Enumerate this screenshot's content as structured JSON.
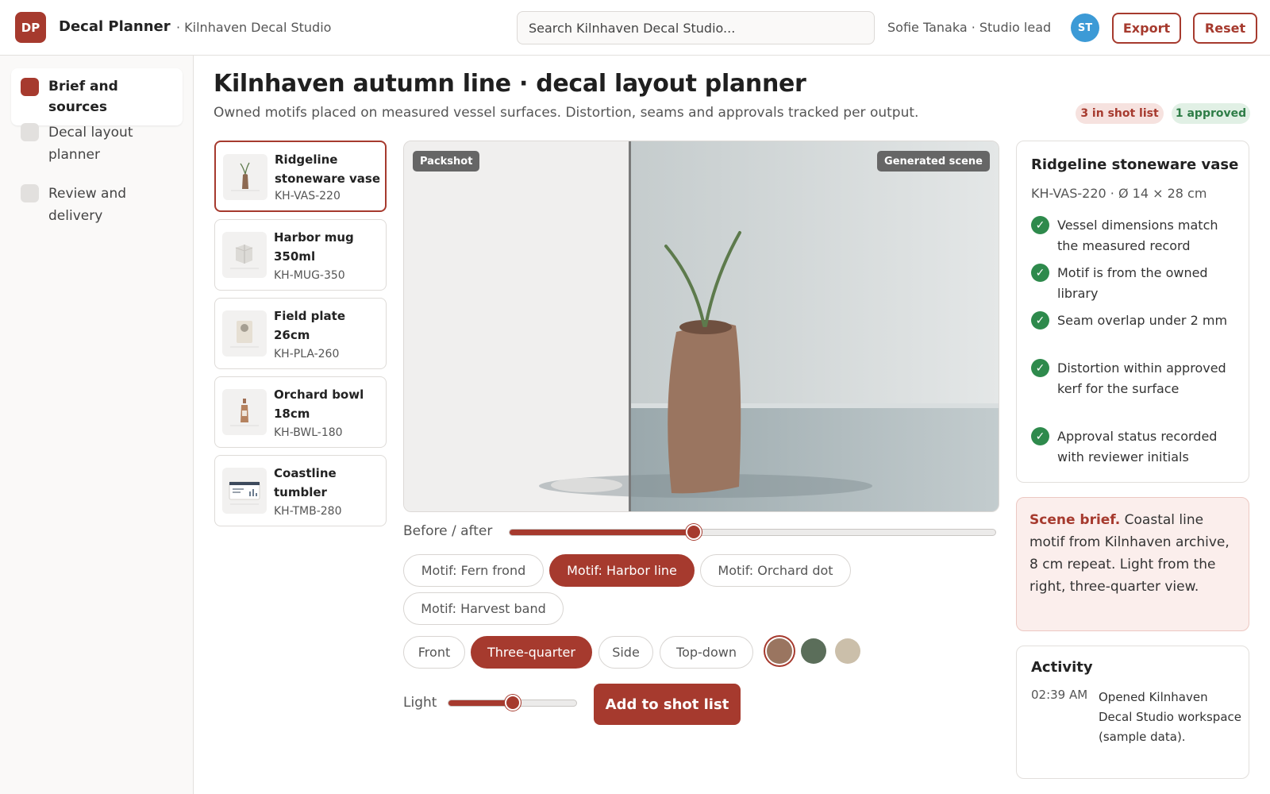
{
  "app": {
    "logo_initials": "DP",
    "name": "Decal Planner",
    "workspace": "· Kilnhaven Decal Studio",
    "search_placeholder": "Search Kilnhaven Decal Studio...",
    "user": "Sofie Tanaka · Studio lead",
    "avatar_initials": "ST",
    "export_label": "Export",
    "reset_label": "Reset"
  },
  "sidebar": {
    "items": [
      {
        "label": "Brief and sources",
        "active": true
      },
      {
        "label": "Decal layout planner",
        "active": false
      },
      {
        "label": "Review and delivery",
        "active": false
      }
    ]
  },
  "header": {
    "title": "Kilnhaven autumn line · decal layout planner",
    "subtitle": "Owned motifs placed on measured vessel surfaces. Distortion, seams and approvals tracked per output.",
    "badge_shot": "3 in shot list",
    "badge_approved": "1 approved"
  },
  "products": [
    {
      "name": "Ridgeline stoneware vase",
      "sku": "KH-VAS-220",
      "selected": true
    },
    {
      "name": "Harbor mug 350ml",
      "sku": "KH-MUG-350",
      "selected": false
    },
    {
      "name": "Field plate 26cm",
      "sku": "KH-PLA-260",
      "selected": false
    },
    {
      "name": "Orchard bowl 18cm",
      "sku": "KH-BWL-180",
      "selected": false
    },
    {
      "name": "Coastline tumbler",
      "sku": "KH-TMB-280",
      "selected": false
    }
  ],
  "preview": {
    "packshot_tag": "Packshot",
    "scene_tag": "Generated scene"
  },
  "controls": {
    "before_after_label": "Before / after",
    "before_after_value": 0.38,
    "motifs": [
      "Motif: Fern frond",
      "Motif: Harbor line",
      "Motif: Orchard dot",
      "Motif: Harvest band"
    ],
    "motif_selected": "Motif: Harbor line",
    "views": [
      "Front",
      "Three-quarter",
      "Side",
      "Top-down"
    ],
    "view_selected": "Three-quarter",
    "swatches": [
      "#9a7560",
      "#5b6e5a",
      "#cbbfaa"
    ],
    "swatch_selected": "#9a7560",
    "light_label": "Light",
    "light_value": 0.5,
    "add_label": "Add to shot list"
  },
  "detail": {
    "title": "Ridgeline stoneware vase",
    "meta": "KH-VAS-220 · Ø 14 × 28 cm",
    "checks": [
      "Vessel dimensions match the measured record",
      "Motif is from the owned library",
      "Seam overlap under 2 mm",
      "Distortion within approved kerf for the surface",
      "Approval status recorded with reviewer initials"
    ]
  },
  "brief": {
    "label": "Scene brief.",
    "text": "Coastal line motif from Kilnhaven archive, 8 cm repeat. Light from the right, three-quarter view."
  },
  "activity": {
    "title": "Activity",
    "entries": [
      {
        "time": "02:39 AM",
        "text": "Opened Kilnhaven Decal Studio workspace (sample data)."
      }
    ]
  },
  "colors": {
    "accent": "#a63a2e",
    "success": "#2e8a4c",
    "avatar": "#3c9ad6"
  }
}
